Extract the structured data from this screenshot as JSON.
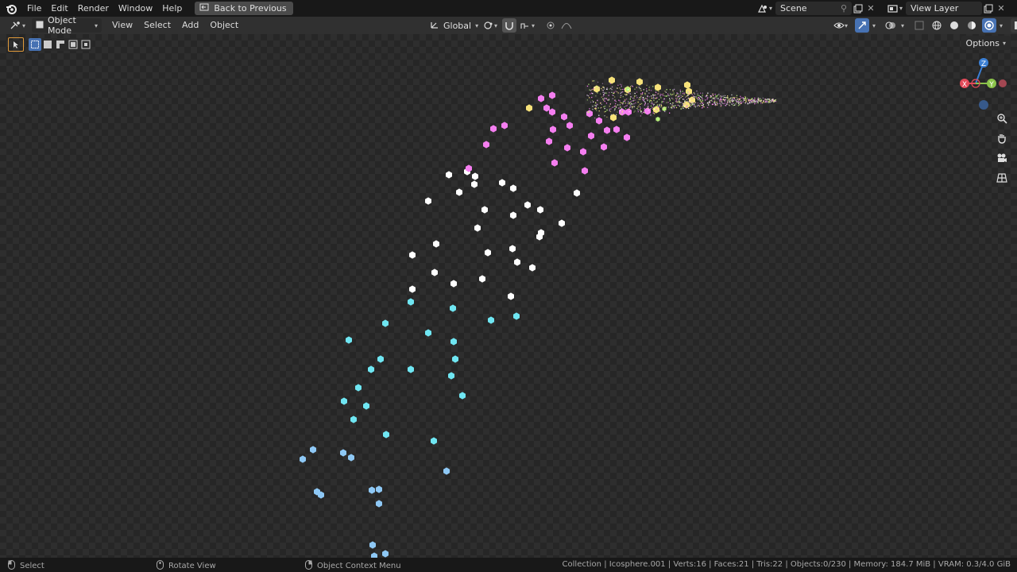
{
  "menu": {
    "items": [
      "File",
      "Edit",
      "Render",
      "Window",
      "Help"
    ],
    "back_label": "Back to Previous"
  },
  "scene": {
    "name": "Scene"
  },
  "view_layer": {
    "name": "View Layer"
  },
  "header": {
    "mode": "Object Mode",
    "menus": [
      "View",
      "Select",
      "Add",
      "Object"
    ],
    "transform_orientation": "Global",
    "options_label": "Options"
  },
  "gizmo": {
    "x": "X",
    "y": "Y",
    "z": "Z"
  },
  "status": {
    "select": "Select",
    "rotate": "Rotate View",
    "context": "Object Context Menu",
    "info": "Collection | Icosphere.001 | Verts:16 | Faces:21 | Tris:22 | Objects:0/230 | Memory: 184.7 MiB | VRAM: 0.3/4.0 GiB"
  },
  "colors": {
    "accent": "#4772b3",
    "particle_white": "#ffffff",
    "particle_cyan": "#6fe6f2",
    "particle_blue": "#8ec8f5",
    "particle_pink": "#f57ef0",
    "particle_yellow": "#f7e27a",
    "particle_green": "#b7f07a",
    "axis_x": "#e24a59",
    "axis_y": "#8bc34a",
    "axis_z": "#3b7fd4"
  }
}
